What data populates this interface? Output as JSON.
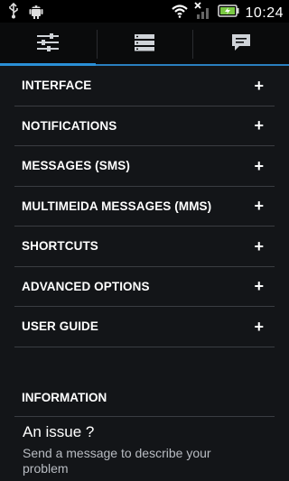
{
  "status_bar": {
    "time": "10:24",
    "icons": [
      "usb-icon",
      "android-debug-icon",
      "wifi-icon",
      "no-signal-icon",
      "battery-charging-icon"
    ]
  },
  "tabs": [
    {
      "name": "settings-tab",
      "icon": "sliders-icon",
      "selected": true
    },
    {
      "name": "list-tab",
      "icon": "list-icon",
      "selected": false
    },
    {
      "name": "messages-tab",
      "icon": "chat-bubble-icon",
      "selected": false
    }
  ],
  "accent_color": "#2a8fd6",
  "sections": [
    {
      "label": "INTERFACE",
      "action": "+"
    },
    {
      "label": "NOTIFICATIONS",
      "action": "+"
    },
    {
      "label": "MESSAGES (SMS)",
      "action": "+"
    },
    {
      "label": "MULTIMEIDA MESSAGES (MMS)",
      "action": "+"
    },
    {
      "label": "SHORTCUTS",
      "action": "+"
    },
    {
      "label": "ADVANCED OPTIONS",
      "action": "+"
    },
    {
      "label": "USER GUIDE",
      "action": "+"
    }
  ],
  "information": {
    "header": "INFORMATION",
    "issue_title": "An issue ?",
    "issue_desc": "Send a message to describe your problem"
  }
}
